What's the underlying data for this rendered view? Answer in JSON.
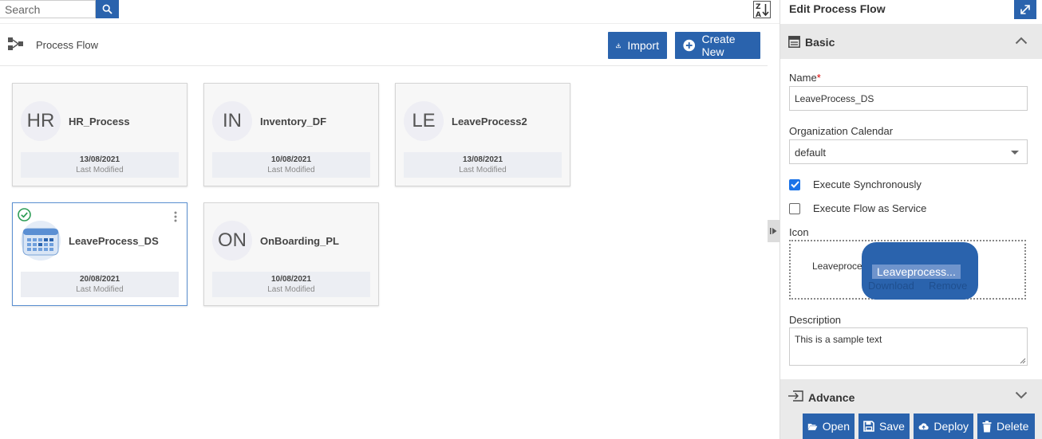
{
  "search": {
    "placeholder": "Search"
  },
  "header": {
    "title": "Process Flow",
    "import_label": "Import",
    "create_label": "Create New"
  },
  "cards": [
    {
      "initials": "HR",
      "name": "HR_Process",
      "date": "13/08/2021",
      "sub": "Last Modified"
    },
    {
      "initials": "IN",
      "name": "Inventory_DF",
      "date": "10/08/2021",
      "sub": "Last Modified"
    },
    {
      "initials": "LE",
      "name": "LeaveProcess2",
      "date": "13/08/2021",
      "sub": "Last Modified"
    },
    {
      "initials": "",
      "name": "LeaveProcess_DS",
      "date": "20/08/2021",
      "sub": "Last Modified",
      "selected": true,
      "icon": "calendar-icon"
    },
    {
      "initials": "ON",
      "name": "OnBoarding_PL",
      "date": "10/08/2021",
      "sub": "Last Modified"
    }
  ],
  "panel": {
    "title": "Edit Process Flow",
    "basic_label": "Basic",
    "name_label": "Name",
    "name_required_mark": "*",
    "name_value": "LeaveProcess_DS",
    "calendar_label": "Organization Calendar",
    "calendar_value": "default",
    "exec_sync_label": "Execute Synchronously",
    "exec_sync_checked": true,
    "exec_service_label": "Execute Flow as Service",
    "exec_service_checked": false,
    "icon_label": "Icon",
    "icon_file_label": "Leaveproce",
    "icon_file_name": "Leaveprocess...",
    "icon_download": "Download",
    "icon_remove": "Remove",
    "description_label": "Description",
    "description_value": "This is a sample text",
    "advance_label": "Advance"
  },
  "footer": {
    "open": "Open",
    "save": "Save",
    "deploy": "Deploy",
    "delete": "Delete"
  },
  "colors": {
    "primary": "#2a63ad",
    "checkbox": "#1a73e8",
    "success": "#2e9e57"
  }
}
